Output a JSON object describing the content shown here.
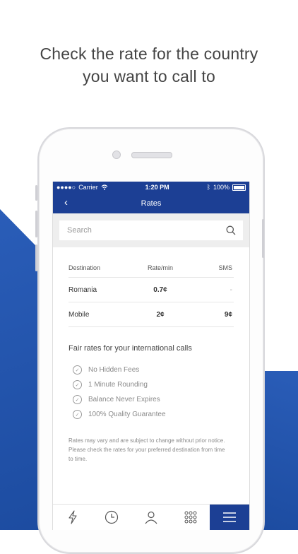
{
  "headline": {
    "line1": "Check the rate for the country",
    "line2": "you want to call to"
  },
  "status": {
    "carrier": "Carrier",
    "time": "1:20 PM",
    "battery": "100%"
  },
  "nav": {
    "title": "Rates"
  },
  "search": {
    "placeholder": "Search"
  },
  "rates": {
    "headers": [
      "Destination",
      "Rate/min",
      "SMS"
    ],
    "rows": [
      {
        "destination": "Romania",
        "rate": "0.7¢",
        "sms": "-"
      },
      {
        "destination": "Mobile",
        "rate": "2¢",
        "sms": "9¢"
      }
    ]
  },
  "features": {
    "title": "Fair rates for your international calls",
    "items": [
      "No Hidden Fees",
      "1 Minute Rounding",
      "Balance Never Expires",
      "100% Quality Guarantee"
    ]
  },
  "note": {
    "line1": "Rates may vary and are subject to change without prior notice.",
    "line2": "Please check the rates for your preferred destination from time",
    "line3": "to time."
  },
  "colors": {
    "brand": "#1c3f94",
    "accent": "#2a5db8"
  },
  "tabs": [
    {
      "icon": "lightning-icon"
    },
    {
      "icon": "clock-icon"
    },
    {
      "icon": "contact-icon"
    },
    {
      "icon": "keypad-icon"
    },
    {
      "icon": "menu-icon",
      "active": true
    }
  ]
}
